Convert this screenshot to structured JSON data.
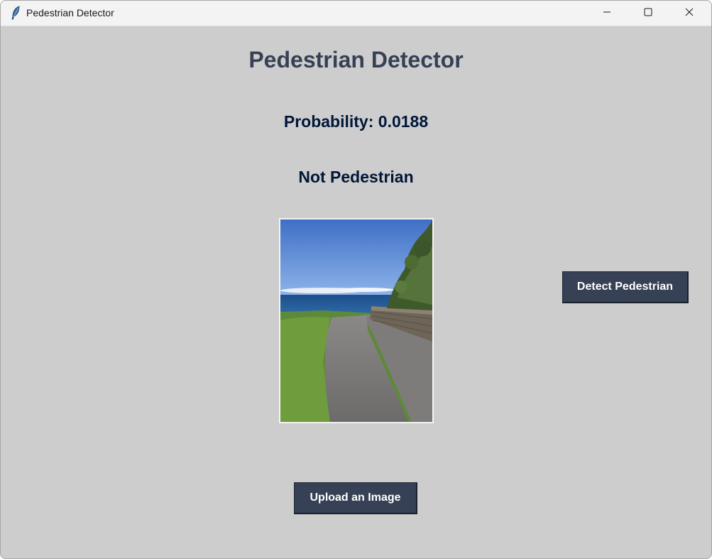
{
  "window": {
    "title": "Pedestrian Detector"
  },
  "main": {
    "heading": "Pedestrian Detector",
    "probability_text": "Probability: 0.0188",
    "result_text": "Not Pedestrian",
    "image_alt": "coastal road photo",
    "detect_button_label": "Detect Pedestrian",
    "upload_button_label": "Upload an Image"
  },
  "colors": {
    "background": "#cdcdcd",
    "heading": "#364156",
    "text": "#011638",
    "button_bg": "#364156",
    "button_text": "#ffffff"
  },
  "icons": {
    "app": "feather-icon",
    "minimize": "minimize-icon",
    "maximize": "maximize-icon",
    "close": "close-icon"
  }
}
